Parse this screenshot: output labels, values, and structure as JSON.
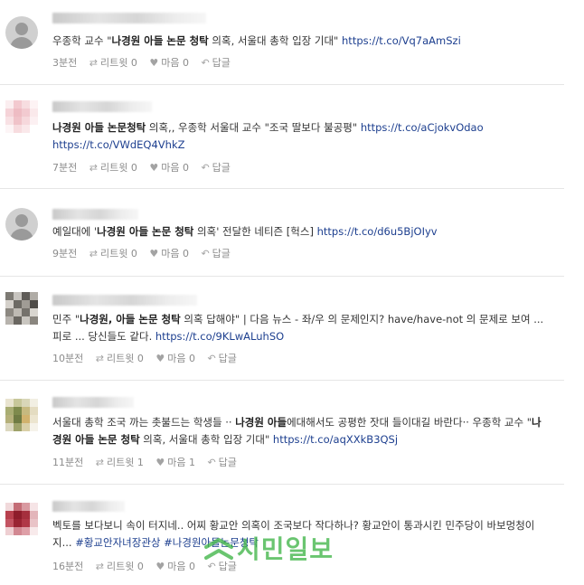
{
  "tweets": [
    {
      "avatar": "default-avatar",
      "segments": [
        {
          "t": "우종학 교수 \"",
          "s": "plain"
        },
        {
          "t": "나경원 아들 논문 청탁",
          "s": "bold"
        },
        {
          "t": " 의혹, 서울대 총학 입장 기대\" ",
          "s": "plain"
        },
        {
          "t": "https://t.co/Vq7aAmSzi",
          "s": "link"
        }
      ],
      "time": "3분전",
      "retweet": "리트윗 0",
      "like": "마음 0",
      "reply": "답글"
    },
    {
      "avatar": "blurred-avatar-pink",
      "segments": [
        {
          "t": "나경원 아들 논문청탁",
          "s": "bold"
        },
        {
          "t": " 의혹,, 우종학 서울대 교수 \"조국 딸보다 불공평\" ",
          "s": "plain"
        },
        {
          "t": "https://t.co/aCjokvOdao https://t.co/VWdEQ4VhkZ",
          "s": "link"
        }
      ],
      "time": "7분전",
      "retweet": "리트윗 0",
      "like": "마음 0",
      "reply": "답글"
    },
    {
      "avatar": "default-avatar",
      "segments": [
        {
          "t": "예일대에 '",
          "s": "plain"
        },
        {
          "t": "나경원 아들 논문 청탁",
          "s": "bold"
        },
        {
          "t": " 의혹' 전달한 네티즌 [헉스] ",
          "s": "plain"
        },
        {
          "t": "https://t.co/d6u5BjOIyv",
          "s": "link"
        }
      ],
      "time": "9분전",
      "retweet": "리트윗 0",
      "like": "마음 0",
      "reply": "답글"
    },
    {
      "avatar": "blurred-avatar-gray",
      "segments": [
        {
          "t": "민주 \"",
          "s": "plain"
        },
        {
          "t": "나경원, 아들 논문 청탁",
          "s": "bold"
        },
        {
          "t": " 의혹 답해야\" | 다음 뉴스 - 좌/우 의 문제인지? have/have-not 의 문제로 보여 ... 피로 ... 당신들도 같다. ",
          "s": "plain"
        },
        {
          "t": "https://t.co/9KLwALuhSO",
          "s": "link"
        }
      ],
      "time": "10분전",
      "retweet": "리트윗 0",
      "like": "마음 0",
      "reply": "답글"
    },
    {
      "avatar": "blurred-avatar-olive",
      "segments": [
        {
          "t": "서울대 총학 조국 까는 촛불드는 학생들 ·· ",
          "s": "plain"
        },
        {
          "t": "나경원 아들",
          "s": "bold"
        },
        {
          "t": "에대해서도 공평한 잣대 들이대길 바란다·· 우종학 교수 \"",
          "s": "plain"
        },
        {
          "t": "나경원 아들 논문 청탁",
          "s": "bold"
        },
        {
          "t": " 의혹, 서울대 총학 입장 기대\" ",
          "s": "plain"
        },
        {
          "t": "https://t.co/aqXXkB3QSj",
          "s": "link"
        }
      ],
      "time": "11분전",
      "retweet": "리트윗 1",
      "like": "마음 1",
      "reply": "답글"
    },
    {
      "avatar": "blurred-avatar-red",
      "segments": [
        {
          "t": "벡토를 보다보니 속이 터지네.. 어찌 황교안 의혹이 조국보다 작다하나? 황교안이 통과시킨 민주당이 바보멍청이지... ",
          "s": "plain"
        },
        {
          "t": "#황교안자녀장관상 #나경원아들논문청탁",
          "s": "link"
        }
      ],
      "time": "16분전",
      "retweet": "리트윗 0",
      "like": "마음 0",
      "reply": "답글"
    }
  ],
  "icons": {
    "retweet": "retweet-icon",
    "like": "heart-icon",
    "reply": "reply-icon"
  },
  "colors": {
    "link": "#1d3f8f",
    "meta": "#8c8c8c",
    "watermark": "#41b649"
  },
  "watermark": {
    "text": "시민일보"
  }
}
